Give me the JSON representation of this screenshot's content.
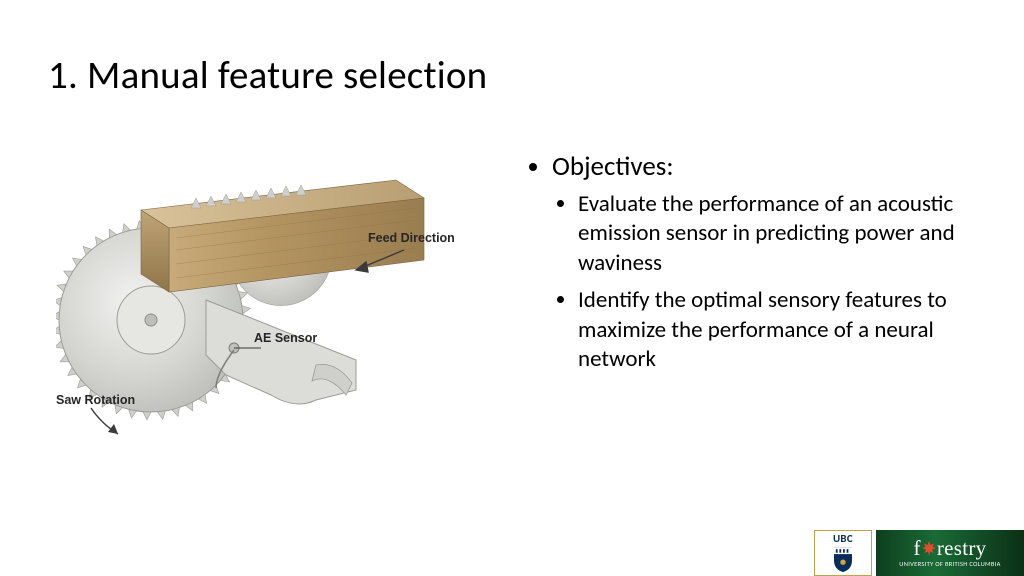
{
  "title": "1. Manual feature selection",
  "figure": {
    "label_feed": "Feed Direction",
    "label_ae": "AE Sensor",
    "label_rot": "Saw Rotation"
  },
  "content": {
    "heading": "Objectives:",
    "bullets": [
      "Evaluate the performance of an acoustic emission sensor in predicting power and waviness",
      "Identify the optimal sensory features to maximize the performance of a neural network"
    ]
  },
  "footer": {
    "ubc": "UBC",
    "forestry": "f",
    "forestry_tail": "restry",
    "forestry_sub": "UNIVERSITY OF BRITISH COLUMBIA"
  }
}
